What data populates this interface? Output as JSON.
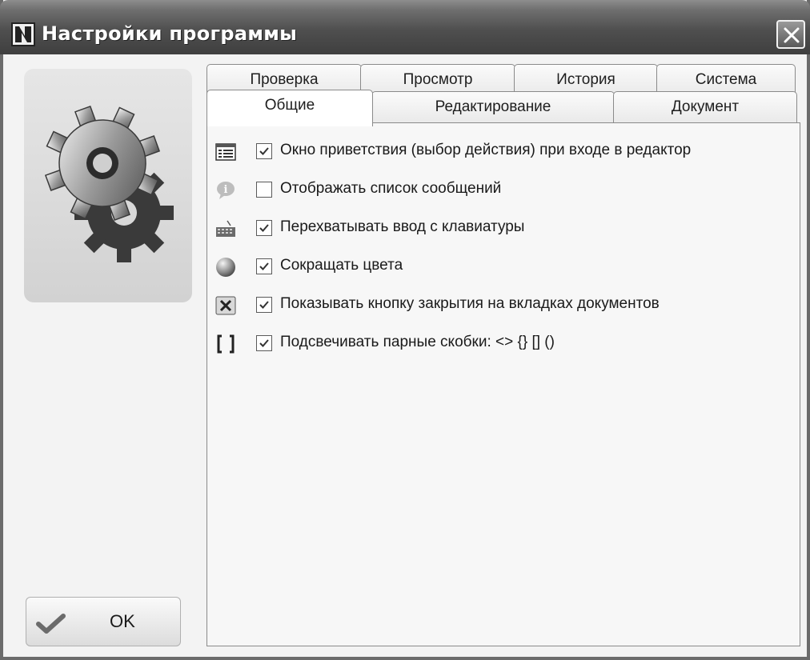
{
  "window": {
    "title": "Настройки программы"
  },
  "tabs": {
    "row1": [
      {
        "label": "Проверка"
      },
      {
        "label": "Просмотр"
      },
      {
        "label": "История"
      },
      {
        "label": "Система"
      }
    ],
    "row2": [
      {
        "label": "Общие",
        "active": true
      },
      {
        "label": "Редактирование"
      },
      {
        "label": "Документ"
      }
    ]
  },
  "options": [
    {
      "label": "Окно приветствия (выбор действия) при входе в редактор",
      "checked": true,
      "icon": "list-window-icon"
    },
    {
      "label": "Отображать список сообщений",
      "checked": false,
      "icon": "info-message-icon"
    },
    {
      "label": "Перехватывать ввод с клавиатуры",
      "checked": true,
      "icon": "keyboard-icon"
    },
    {
      "label": "Сокращать цвета",
      "checked": true,
      "icon": "color-sphere-icon"
    },
    {
      "label": "Показывать кнопку закрытия на вкладках документов",
      "checked": true,
      "icon": "close-tab-icon"
    },
    {
      "label": "Подсвечивать парные скобки: <> {} [] ()",
      "checked": true,
      "icon": "brackets-icon"
    }
  ],
  "buttons": {
    "ok_label": "OK"
  },
  "colors": {
    "titlebar": "#4f4f4f",
    "panel": "#f7f7f7",
    "logo_panel": "#dcdcdc"
  }
}
